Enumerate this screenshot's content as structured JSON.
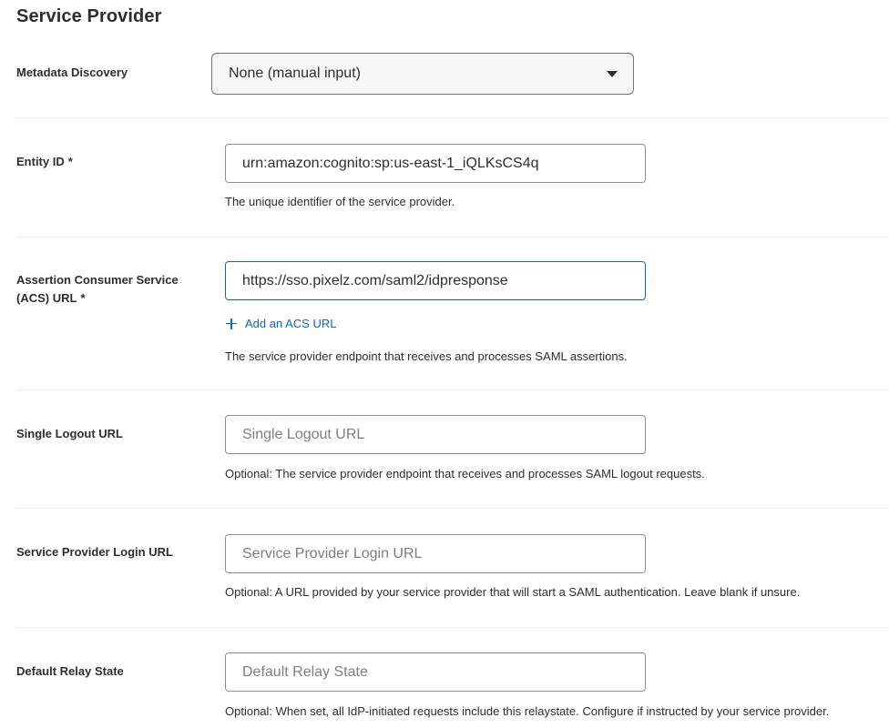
{
  "section": {
    "title": "Service Provider"
  },
  "metadata_discovery": {
    "label": "Metadata Discovery",
    "selected": "None (manual input)"
  },
  "entity_id": {
    "label": "Entity ID",
    "required_mark": "*",
    "value": "urn:amazon:cognito:sp:us-east-1_iQLKsCS4q",
    "help": "The unique identifier of the service provider."
  },
  "acs_url": {
    "label_line1": "Assertion Consumer Service",
    "label_line2": "(ACS) URL",
    "required_mark": "*",
    "value": "https://sso.pixelz.com/saml2/idpresponse",
    "add_link": "Add an ACS URL",
    "help": "The service provider endpoint that receives and processes SAML assertions."
  },
  "single_logout": {
    "label": "Single Logout URL",
    "value": "",
    "placeholder": "Single Logout URL",
    "help": "Optional: The service provider endpoint that receives and processes SAML logout requests."
  },
  "sp_login_url": {
    "label": "Service Provider Login URL",
    "value": "",
    "placeholder": "Service Provider Login URL",
    "help": "Optional: A URL provided by your service provider that will start a SAML authentication. Leave blank if unsure."
  },
  "relay_state": {
    "label": "Default Relay State",
    "value": "",
    "placeholder": "Default Relay State",
    "help": "Optional: When set, all IdP-initiated requests include this relaystate. Configure if instructed by your service provider."
  },
  "colors": {
    "link": "#0b66c3",
    "focus_border": "#0b66c3",
    "text": "#2b2f33",
    "divider": "#eceef0"
  },
  "icons": {
    "dropdown": "caret-down-icon",
    "add": "plus-icon"
  }
}
